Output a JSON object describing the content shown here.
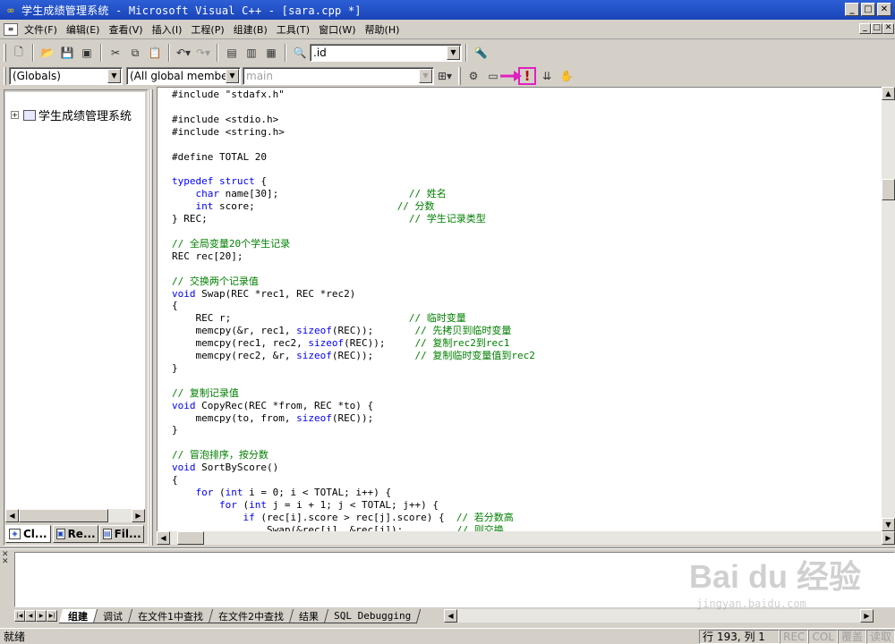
{
  "window": {
    "title": "学生成绩管理系统 - Microsoft Visual C++ - [sara.cpp *]",
    "min": "_",
    "max": "□",
    "close": "✕"
  },
  "menu": [
    "文件(F)",
    "编辑(E)",
    "查看(V)",
    "插入(I)",
    "工程(P)",
    "组建(B)",
    "工具(T)",
    "窗口(W)",
    "帮助(H)"
  ],
  "toolbar1": {
    "find_value": ".id"
  },
  "toolbar2": {
    "scope": "(Globals)",
    "members": "(All global members",
    "function": "main",
    "highlight_color": "#e020c0",
    "execute_glyph": "!"
  },
  "workspace": {
    "tree_root": "学生成绩管理系统",
    "tabs": [
      "Cl...",
      "Re...",
      "Fil..."
    ]
  },
  "editor": {
    "lines": [
      [
        [
          "#include \"stdafx.h\"",
          "n"
        ]
      ],
      [
        [
          "",
          "n"
        ]
      ],
      [
        [
          "#include <stdio.h>",
          "n"
        ]
      ],
      [
        [
          "#include <string.h>",
          "n"
        ]
      ],
      [
        [
          "",
          "n"
        ]
      ],
      [
        [
          "#define TOTAL 20",
          "n"
        ]
      ],
      [
        [
          "",
          "n"
        ]
      ],
      [
        [
          "typedef struct",
          "k"
        ],
        [
          " {",
          "n"
        ]
      ],
      [
        [
          "    ",
          "n"
        ],
        [
          "char",
          "k"
        ],
        [
          " name[30];                      ",
          "n"
        ],
        [
          "// 姓名",
          "c"
        ]
      ],
      [
        [
          "    ",
          "n"
        ],
        [
          "int",
          "k"
        ],
        [
          " score;                        ",
          "n"
        ],
        [
          "// 分数",
          "c"
        ]
      ],
      [
        [
          "} REC;                                  ",
          "n"
        ],
        [
          "// 学生记录类型",
          "c"
        ]
      ],
      [
        [
          "",
          "n"
        ]
      ],
      [
        [
          "// 全局变量20个学生记录",
          "c"
        ]
      ],
      [
        [
          "REC rec[20];",
          "n"
        ]
      ],
      [
        [
          "",
          "n"
        ]
      ],
      [
        [
          "// 交换两个记录值",
          "c"
        ]
      ],
      [
        [
          "void",
          "k"
        ],
        [
          " Swap(REC *rec1, REC *rec2)",
          "n"
        ]
      ],
      [
        [
          "{",
          "n"
        ]
      ],
      [
        [
          "    REC r;                              ",
          "n"
        ],
        [
          "// 临时变量",
          "c"
        ]
      ],
      [
        [
          "    memcpy(&r, rec1, ",
          "n"
        ],
        [
          "sizeof",
          "k"
        ],
        [
          "(REC));       ",
          "n"
        ],
        [
          "// 先拷贝到临时变量",
          "c"
        ]
      ],
      [
        [
          "    memcpy(rec1, rec2, ",
          "n"
        ],
        [
          "sizeof",
          "k"
        ],
        [
          "(REC));     ",
          "n"
        ],
        [
          "// 复制rec2到rec1",
          "c"
        ]
      ],
      [
        [
          "    memcpy(rec2, &r, ",
          "n"
        ],
        [
          "sizeof",
          "k"
        ],
        [
          "(REC));       ",
          "n"
        ],
        [
          "// 复制临时变量值到rec2",
          "c"
        ]
      ],
      [
        [
          "}",
          "n"
        ]
      ],
      [
        [
          "",
          "n"
        ]
      ],
      [
        [
          "// 复制记录值",
          "c"
        ]
      ],
      [
        [
          "void",
          "k"
        ],
        [
          " CopyRec(REC *from, REC *to) {",
          "n"
        ]
      ],
      [
        [
          "    memcpy(to, from, ",
          "n"
        ],
        [
          "sizeof",
          "k"
        ],
        [
          "(REC));",
          "n"
        ]
      ],
      [
        [
          "}",
          "n"
        ]
      ],
      [
        [
          "",
          "n"
        ]
      ],
      [
        [
          "// 冒泡排序，按分数",
          "c"
        ]
      ],
      [
        [
          "void",
          "k"
        ],
        [
          " SortByScore()",
          "n"
        ]
      ],
      [
        [
          "{",
          "n"
        ]
      ],
      [
        [
          "    ",
          "n"
        ],
        [
          "for",
          "k"
        ],
        [
          " (",
          "n"
        ],
        [
          "int",
          "k"
        ],
        [
          " i = 0; i < TOTAL; i++) {",
          "n"
        ]
      ],
      [
        [
          "        ",
          "n"
        ],
        [
          "for",
          "k"
        ],
        [
          " (",
          "n"
        ],
        [
          "int",
          "k"
        ],
        [
          " j = i + 1; j < TOTAL; j++) {",
          "n"
        ]
      ],
      [
        [
          "            ",
          "n"
        ],
        [
          "if",
          "k"
        ],
        [
          " (rec[i].score > rec[j].score) {  ",
          "n"
        ],
        [
          "// 若分数高",
          "c"
        ]
      ],
      [
        [
          "                Swap(&rec[i], &rec[j]);         ",
          "n"
        ],
        [
          "// 则交换",
          "c"
        ]
      ]
    ]
  },
  "output": {
    "tabs": [
      "组建",
      "调试",
      "在文件1中查找",
      "在文件2中查找",
      "结果",
      "SQL Debugging"
    ]
  },
  "status": {
    "text": "就绪",
    "position": "行 193, 列 1",
    "indicators": [
      "REC",
      "COL",
      "覆盖",
      "读取"
    ]
  },
  "watermark": {
    "big": "Bai du 经验",
    "small": "jingyan.baidu.com"
  }
}
